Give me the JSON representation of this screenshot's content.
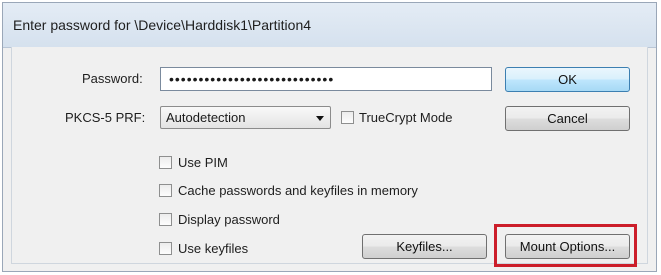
{
  "window": {
    "title": "Enter password for \\Device\\Harddisk1\\Partition4"
  },
  "password": {
    "label": "Password:",
    "value": "••••••••••••••••••••••••••••"
  },
  "prf": {
    "label": "PKCS-5 PRF:",
    "selected": "Autodetection"
  },
  "checkboxes": {
    "truecrypt_mode": {
      "label": "TrueCrypt Mode",
      "checked": false
    },
    "use_pim": {
      "label": "Use PIM",
      "checked": false
    },
    "cache_passwords": {
      "label": "Cache passwords and keyfiles in memory",
      "checked": false
    },
    "display_password": {
      "label": "Display password",
      "checked": false
    },
    "use_keyfiles": {
      "label": "Use keyfiles",
      "checked": false
    }
  },
  "buttons": {
    "ok": "OK",
    "cancel": "Cancel",
    "keyfiles": "Keyfiles...",
    "mount_options": "Mount Options..."
  },
  "colors": {
    "highlight": "#cc1e2a",
    "default_button_border": "#3c7fb1"
  }
}
